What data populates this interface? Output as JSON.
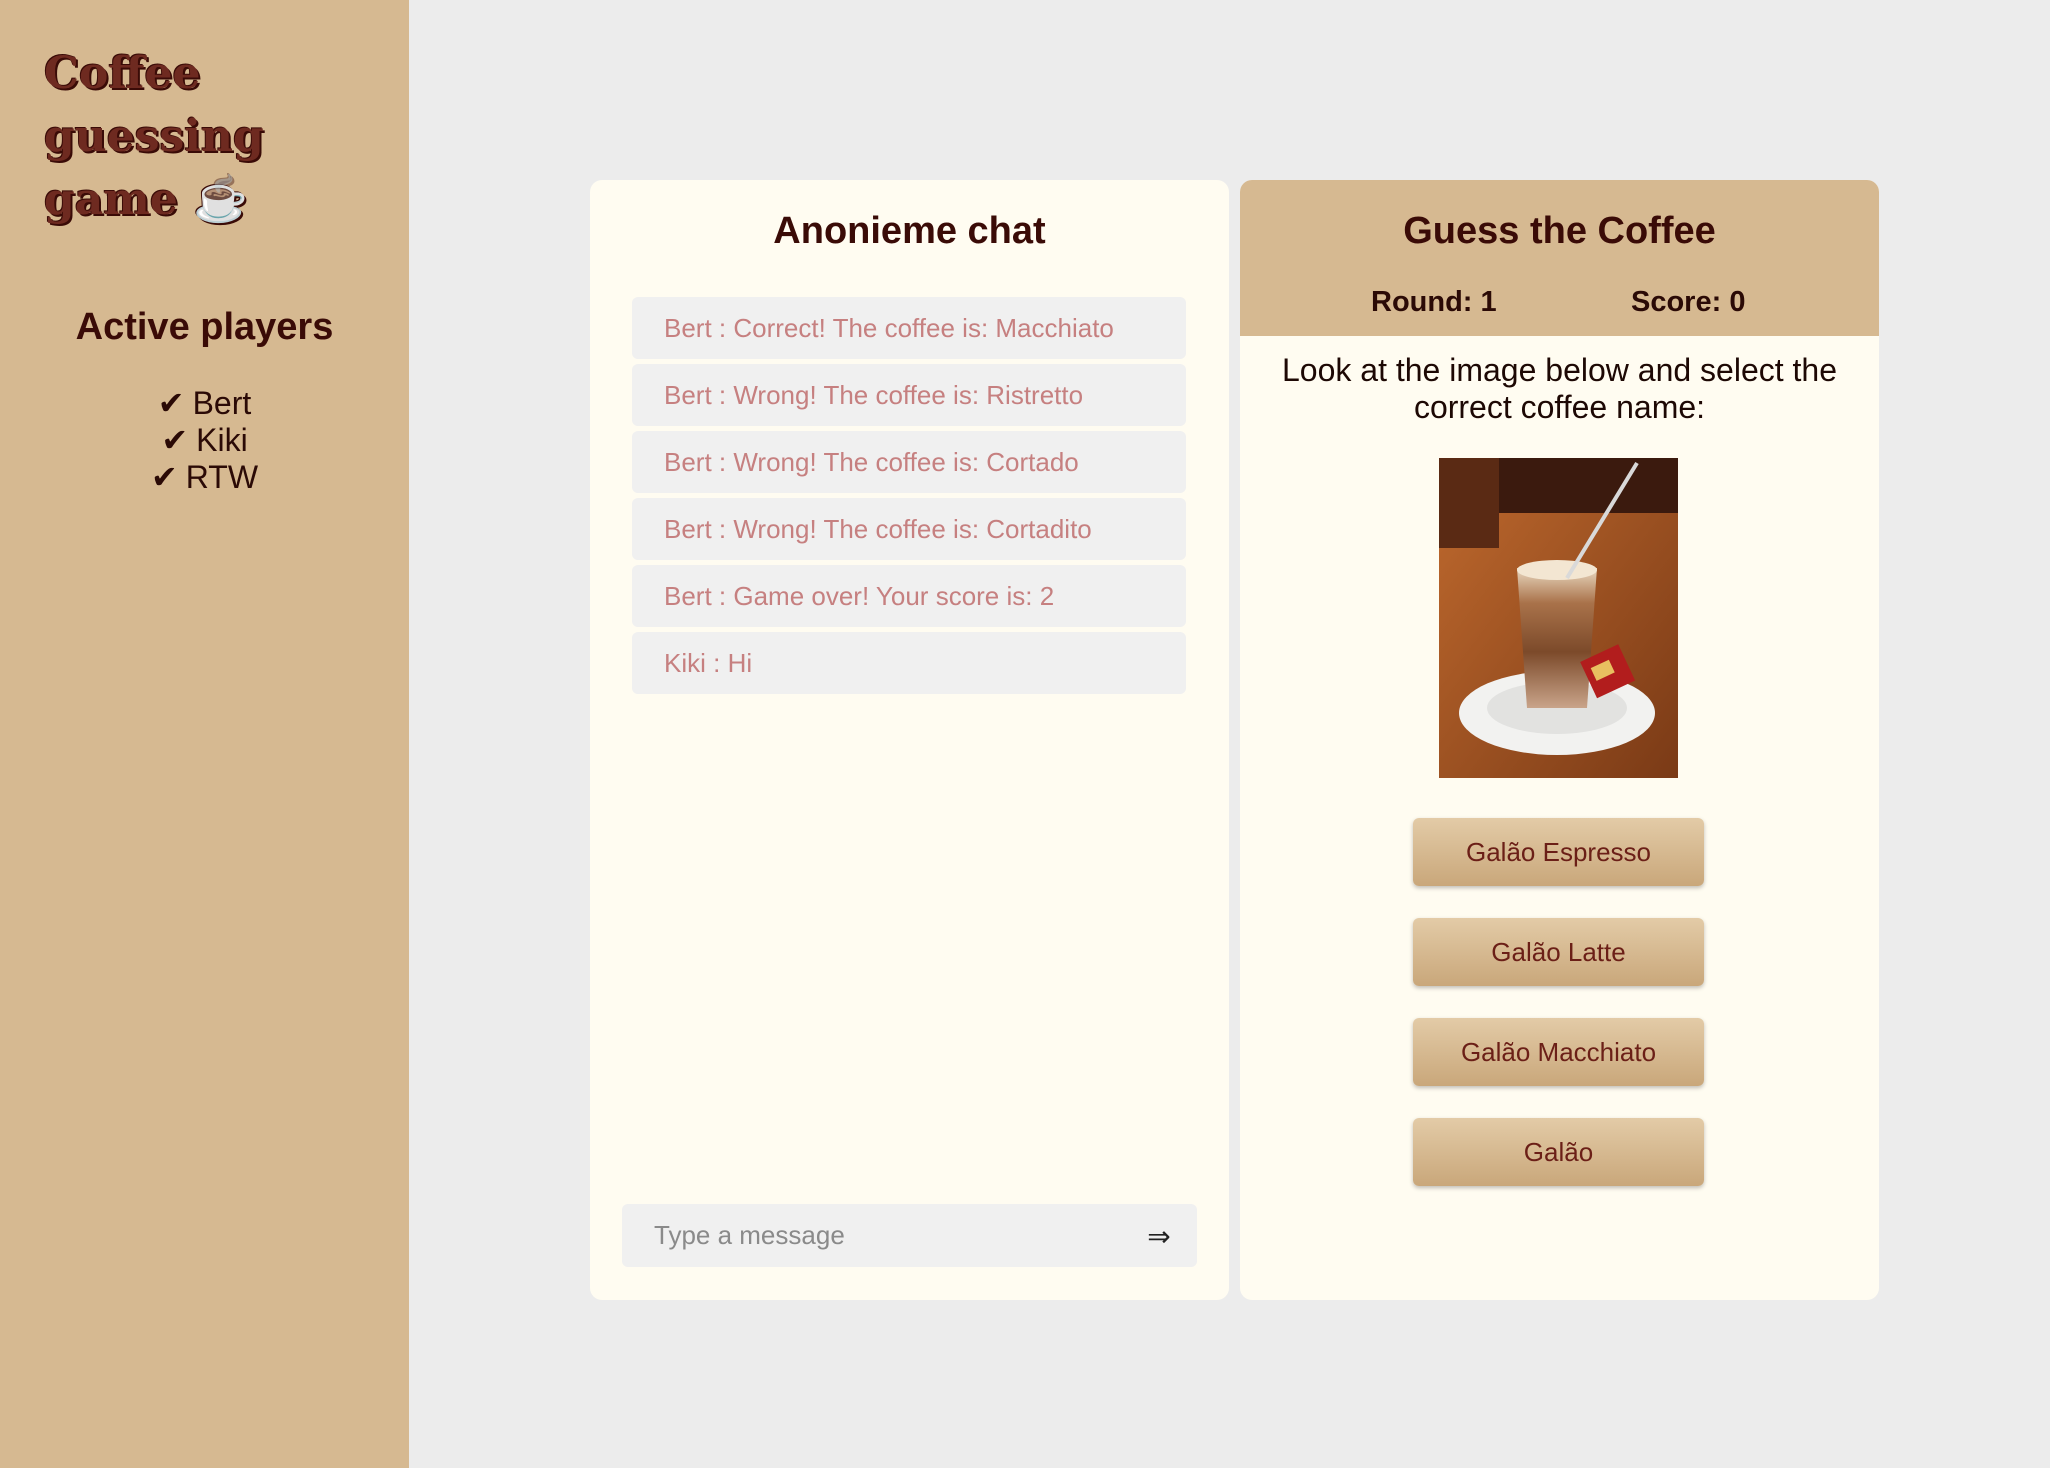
{
  "sidebar": {
    "app_title": "Coffee guessing game ☕",
    "players_title": "Active players",
    "players": [
      {
        "check": "✔",
        "name": "Bert"
      },
      {
        "check": "✔",
        "name": "Kiki"
      },
      {
        "check": "✔",
        "name": "RTW"
      }
    ]
  },
  "chat": {
    "title": "Anonieme chat",
    "messages": [
      {
        "text": "Bert : Correct! The coffee is: Macchiato"
      },
      {
        "text": "Bert : Wrong! The coffee is: Ristretto"
      },
      {
        "text": "Bert : Wrong! The coffee is: Cortado"
      },
      {
        "text": "Bert : Wrong! The coffee is: Cortadito"
      },
      {
        "text": "Bert : Game over! Your score is: 2"
      },
      {
        "text": "Kiki : Hi"
      }
    ],
    "input_placeholder": "Type a message",
    "send_icon": "⇒"
  },
  "game": {
    "title": "Guess the Coffee",
    "round": "Round: 1",
    "score": "Score: 0",
    "instructions": "Look at the image below and select the correct coffee name:",
    "options": [
      {
        "label": "Galão Espresso"
      },
      {
        "label": "Galão Latte"
      },
      {
        "label": "Galão Macchiato"
      },
      {
        "label": "Galão"
      }
    ]
  },
  "colors": {
    "sidebar_bg": "#d6b991",
    "panel_bg": "#fffcf1",
    "page_bg": "#ececec",
    "heading": "#3a0b07",
    "message_text": "#c68080",
    "button_text": "#6b1f17"
  }
}
